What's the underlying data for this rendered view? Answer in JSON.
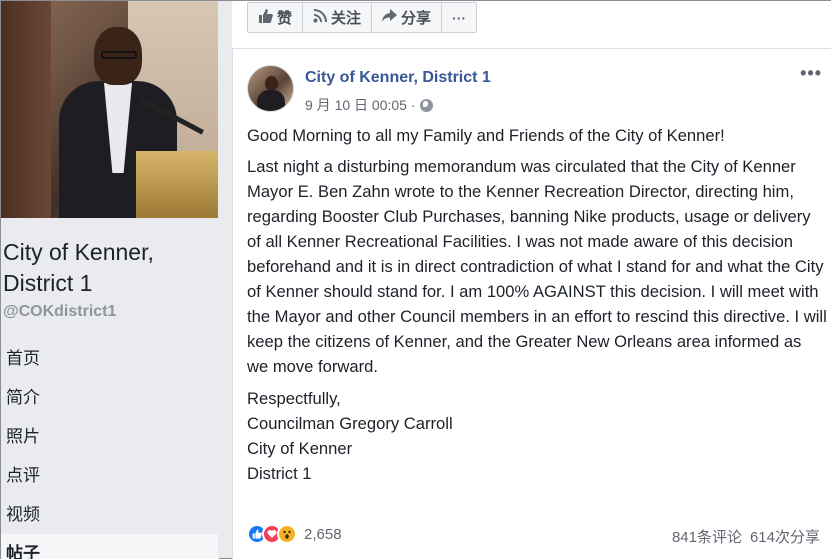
{
  "sidebar": {
    "page_name": "City of Kenner, District 1",
    "handle": "@COKdistrict1",
    "nav": [
      {
        "label": "首页"
      },
      {
        "label": "简介"
      },
      {
        "label": "照片"
      },
      {
        "label": "点评"
      },
      {
        "label": "视频"
      },
      {
        "label": "帖子"
      }
    ]
  },
  "toolbar": {
    "like_label": "赞",
    "follow_label": "关注",
    "share_label": "分享",
    "more_label": "···"
  },
  "post": {
    "author": "City of Kenner, District 1",
    "timestamp": "9 月 10 日 00:05 ·",
    "more_label": "•••",
    "greeting": "Good Morning to all my Family and Friends of the City of Kenner!",
    "body": "Last night a disturbing memorandum was circulated that the City of Kenner Mayor E. Ben Zahn wrote to the Kenner Recreation Director, directing him, regarding Booster Club Purchases, banning Nike products, usage or delivery of all Kenner Recreational Facilities. I was not made aware of this decision beforehand and it is in direct contradiction of what I stand for and what the City of Kenner should stand for. I am 100% AGAINST this decision. I will meet with the Mayor and other Council members in an effort to rescind this directive. I will keep the citizens of Kenner, and the Greater New Orleans area informed as we move forward.",
    "signoff": [
      "Respectfully,",
      "Councilman Gregory Carroll",
      "City of Kenner",
      "District 1"
    ],
    "reaction_count": "2,658",
    "comments": "841条评论",
    "shares": "614次分享"
  },
  "colors": {
    "link": "#385898",
    "like_blue": "#1877f2",
    "love_red": "#f33e58",
    "wow_yellow": "#f7b125"
  }
}
